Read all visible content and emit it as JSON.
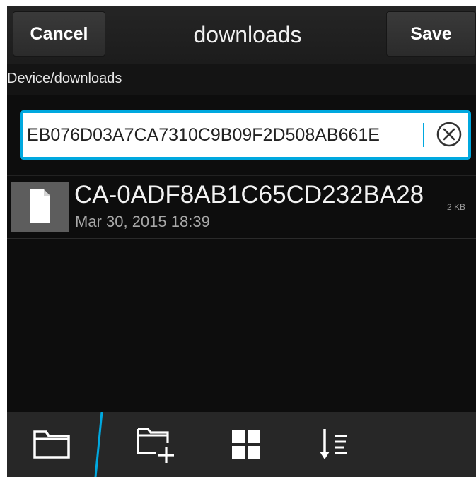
{
  "titlebar": {
    "cancel_label": "Cancel",
    "title": "downloads",
    "save_label": "Save"
  },
  "path": "Device/downloads",
  "filename_field": {
    "value": "EB076D03A7CA7310C9B09F2D508AB661E",
    "clear_icon": "clear-circle-x-icon"
  },
  "files": [
    {
      "name": "CA-0ADF8AB1C65CD232BA28",
      "date": "Mar 30, 2015 18:39",
      "size": "2 KB",
      "icon": "document-icon"
    }
  ],
  "actionbar": {
    "items": [
      {
        "icon": "folder-icon"
      },
      {
        "icon": "new-folder-icon"
      },
      {
        "icon": "grid-view-icon"
      },
      {
        "icon": "sort-icon"
      }
    ]
  },
  "colors": {
    "accent": "#00a8df",
    "background": "#0d0d0d",
    "actionbar": "#272727"
  }
}
